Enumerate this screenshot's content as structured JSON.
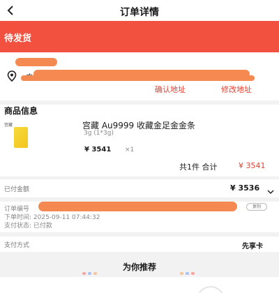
{
  "navbar": {
    "title": "订单详情",
    "back_icon": "chevron-left-icon"
  },
  "status": {
    "text": "待发货",
    "color": "#f2513f"
  },
  "address": {
    "prefix": "广",
    "confirm_label": "确认地址",
    "modify_label": "修改地址",
    "icon": "location-pin-icon",
    "accent": "#e63f2f"
  },
  "product": {
    "section_title": "商品信息",
    "shop_logo_text": "宫藏",
    "title": "宫藏 Au9999 收藏金足金金条",
    "spec": "3g (1*3g)",
    "price": "¥ 3541",
    "qty": "×1",
    "total_label": "共1件 合计",
    "total_amount": "¥ 3541"
  },
  "payment": {
    "paid_label": "已付金额",
    "paid_amount": "¥ 3536",
    "chevron_icon": "chevron-down-icon"
  },
  "order_info": {
    "order_no_label": "订单编号",
    "copy_label": "复制",
    "order_time": "下单时间: 2025-09-11 07:44:32",
    "pay_status": "支付状态: 已付款"
  },
  "pay_method": {
    "label": "支付方式",
    "value": "先享卡"
  },
  "recommend": {
    "title": "为你推荐"
  }
}
